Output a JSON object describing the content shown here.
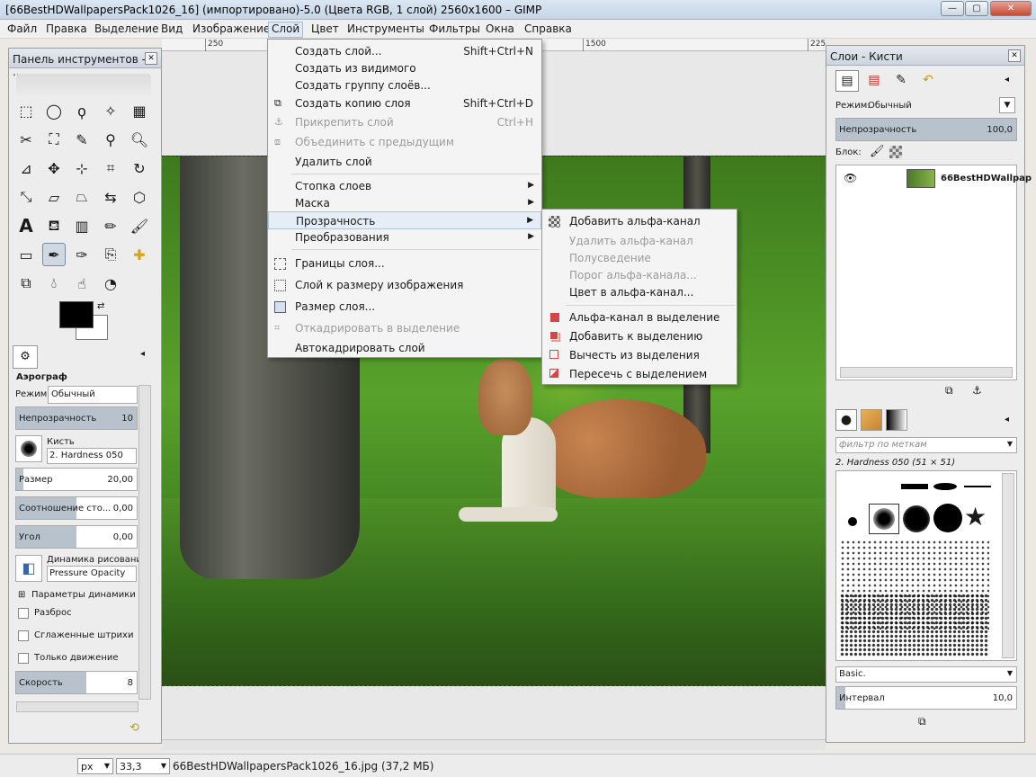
{
  "window": {
    "title": "[66BestHDWallpapersPack1026_16] (импортировано)-5.0 (Цвета RGB, 1 слой) 2560x1600 – GIMP",
    "min": "—",
    "max": "▢",
    "close": "✕"
  },
  "menubar": [
    "Файл",
    "Правка",
    "Выделение",
    "Вид",
    "Изображение",
    "Слой",
    "Цвет",
    "Инструменты",
    "Фильтры",
    "Окна",
    "Справка"
  ],
  "ruler": [
    "250",
    "1500",
    "225"
  ],
  "toolbox": {
    "title": "Панель инструментов - ...",
    "tool_name": "Аэрограф",
    "mode_label": "Режим:",
    "mode_value": "Обычный",
    "opacity_label": "Непрозрачность",
    "opacity_value": "10",
    "brush_label": "Кисть",
    "brush_value": "2. Hardness 050",
    "size_label": "Размер",
    "size_value": "20,00",
    "ratio_label": "Соотношение сто...",
    "ratio_value": "0,00",
    "angle_label": "Угол",
    "angle_value": "0,00",
    "dynamics_label": "Динамика рисования",
    "dynamics_value": "Pressure Opacity",
    "dyn_params": "Параметры динамики",
    "scatter": "Разброс",
    "smooth": "Сглаженные штрихи",
    "motion_only": "Только движение",
    "speed_label": "Скорость",
    "speed_value": "8"
  },
  "layer_menu": [
    {
      "label": "Создать слой...",
      "shortcut": "Shift+Ctrl+N",
      "disabled": false
    },
    {
      "label": "Создать из видимого",
      "shortcut": "",
      "disabled": false
    },
    {
      "label": "Создать группу слоёв...",
      "shortcut": "",
      "disabled": false
    },
    {
      "label": "Создать копию слоя",
      "shortcut": "Shift+Ctrl+D",
      "disabled": false
    },
    {
      "label": "Прикрепить слой",
      "shortcut": "Ctrl+H",
      "disabled": true
    },
    {
      "label": "Объединить с предыдущим",
      "shortcut": "",
      "disabled": true
    },
    {
      "label": "Удалить слой",
      "shortcut": "",
      "disabled": false
    },
    {
      "label": "Стопка слоев",
      "shortcut": "",
      "disabled": false
    },
    {
      "label": "Маска",
      "shortcut": "",
      "disabled": false
    },
    {
      "label": "Прозрачность",
      "shortcut": "",
      "disabled": false
    },
    {
      "label": "Преобразования",
      "shortcut": "",
      "disabled": false
    },
    {
      "label": "Границы слоя...",
      "shortcut": "",
      "disabled": false
    },
    {
      "label": "Слой к размеру изображения",
      "shortcut": "",
      "disabled": false
    },
    {
      "label": "Размер слоя...",
      "shortcut": "",
      "disabled": false
    },
    {
      "label": "Откадрировать в выделение",
      "shortcut": "",
      "disabled": true
    },
    {
      "label": "Автокадрировать слой",
      "shortcut": "",
      "disabled": false
    }
  ],
  "transparency_menu": [
    {
      "label": "Добавить альфа-канал",
      "disabled": false
    },
    {
      "label": "Удалить альфа-канал",
      "disabled": true
    },
    {
      "label": "Полусведение",
      "disabled": true
    },
    {
      "label": "Порог альфа-канала...",
      "disabled": true
    },
    {
      "label": "Цвет в альфа-канал...",
      "disabled": false
    },
    {
      "label": "Альфа-канал в выделение",
      "disabled": false
    },
    {
      "label": "Добавить к выделению",
      "disabled": false
    },
    {
      "label": "Вычесть из выделения",
      "disabled": false
    },
    {
      "label": "Пересечь с выделением",
      "disabled": false
    }
  ],
  "layers_dock": {
    "title": "Слои - Кисти",
    "mode_label": "Режим:",
    "mode_value": "Обычный",
    "opacity_label": "Непрозрачность",
    "opacity_value": "100,0",
    "lock_label": "Блок:",
    "layer_name": "66BestHDWallpap",
    "brush_filter": "фильтр по меткам",
    "brush_name": "2. Hardness 050 (51 × 51)",
    "brush_set": "Basic.",
    "interval_label": "Интервал",
    "interval_value": "10,0"
  },
  "statusbar": {
    "unit": "px",
    "zoom": "33,3",
    "file": "66BestHDWallpapersPack1026_16.jpg (37,2 МБ)"
  },
  "colors": {
    "accent": "#dfe8f3",
    "menu_bg": "#f4f4f4",
    "disabled": "#9b9b9b"
  }
}
